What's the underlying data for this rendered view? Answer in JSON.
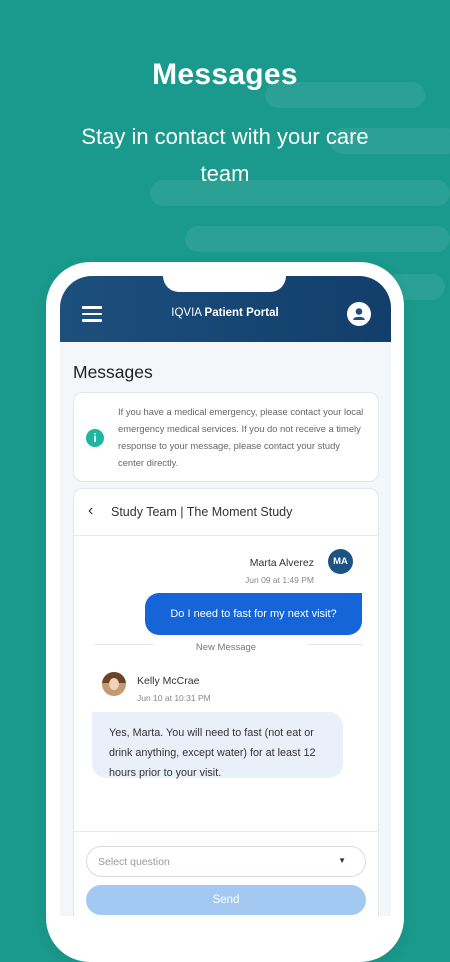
{
  "hero": {
    "title": "Messages",
    "subtitle": "Stay in contact with your care team"
  },
  "app": {
    "brand": "IQVIA",
    "portal_name": "Patient Portal",
    "menu_icon": "hamburger-menu-icon",
    "profile_icon": "user-profile-icon"
  },
  "page": {
    "title": "Messages"
  },
  "notice": {
    "icon": "info-icon",
    "text": "If you have a medical emergency, please contact your local emergency medical services. If you do not receive a timely response to your message, please contact your study center directly."
  },
  "thread": {
    "title": "Study Team | The Moment Study",
    "sent": {
      "sender": "Marta Alverez",
      "initials": "MA",
      "time": "Jun 09 at 1:49 PM",
      "text": "Do I need to fast for my next visit?"
    },
    "divider_label": "New Message",
    "received": {
      "sender": "Kelly McCrae",
      "time": "Jun 10 at 10:31 PM",
      "text": "Yes, Marta. You will need to fast (not eat or drink anything, except water) for at least 12 hours prior to your visit."
    }
  },
  "compose": {
    "select_placeholder": "Select question",
    "send_label": "Send"
  },
  "colors": {
    "background": "#1a9a8c",
    "header": "#1d4f7d",
    "sent_bubble": "#1565d8",
    "received_bubble": "#e9f0fa",
    "send_button": "#a3c9f2",
    "info_accent": "#1fb5a1"
  }
}
